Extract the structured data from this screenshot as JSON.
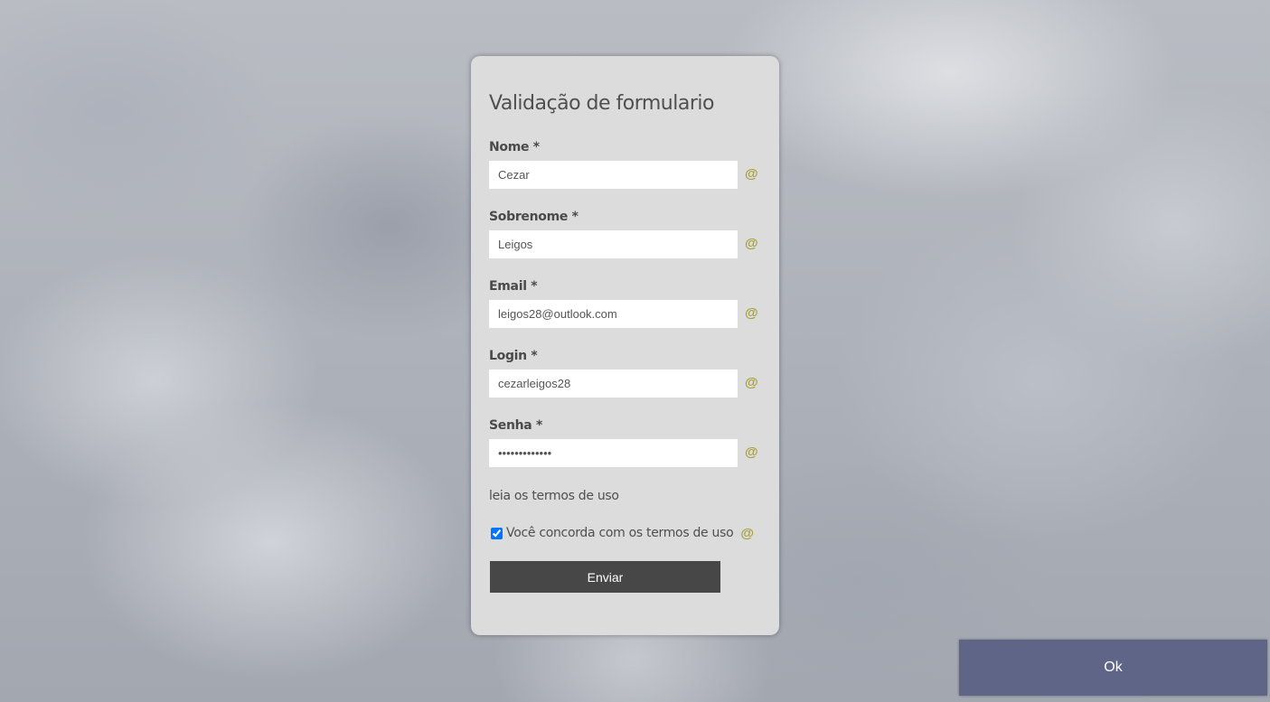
{
  "form": {
    "title": "Validação de formulario",
    "fields": [
      {
        "label": "Nome *",
        "value": "Cezar",
        "icon": "@"
      },
      {
        "label": "Sobrenome *",
        "value": "Leigos",
        "icon": "@"
      },
      {
        "label": "Email *",
        "value": "leigos28@outlook.com",
        "icon": "@"
      },
      {
        "label": "Login *",
        "value": "cezarleigos28",
        "icon": "@"
      },
      {
        "label": "Senha *",
        "value": "•••••••••••••",
        "icon": "@"
      }
    ],
    "terms_link": "leia os termos de uso",
    "agree": {
      "label": "Você concorda com os termos de uso",
      "checked": true,
      "icon": "@"
    },
    "submit_label": "Enviar"
  },
  "dialog": {
    "ok_label": "Ok"
  },
  "colors": {
    "card_background": "#dcdcdc",
    "validation_icon": "#a5a13a",
    "submit_button": "#474747",
    "ok_button": "#5f6586"
  }
}
